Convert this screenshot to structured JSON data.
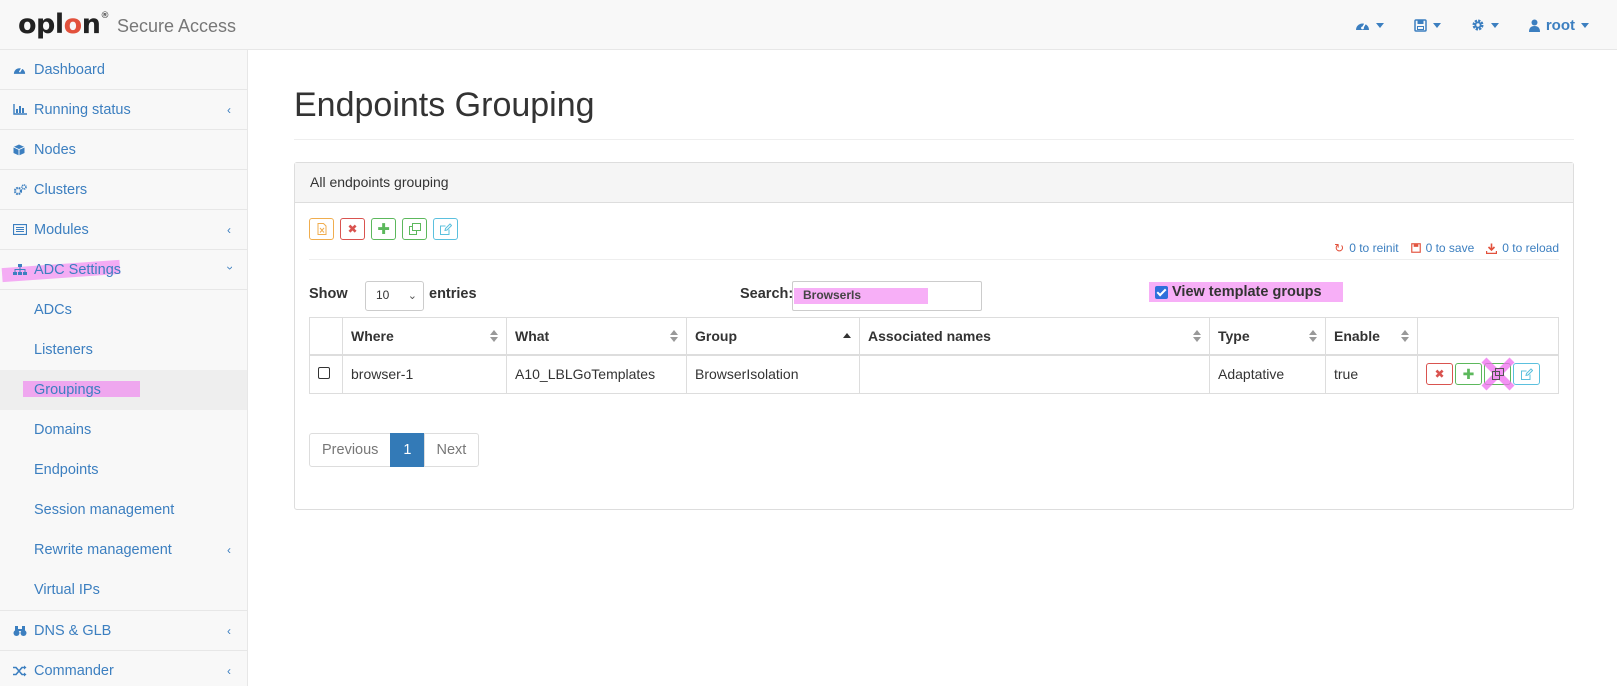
{
  "brand": {
    "name_pre": "opl",
    "name_o": "o",
    "name_post": "n",
    "reg": "®",
    "subtitle": "Secure Access"
  },
  "navbar": {
    "user": "root"
  },
  "sidebar": {
    "items": [
      {
        "label": "Dashboard"
      },
      {
        "label": "Running status"
      },
      {
        "label": "Nodes"
      },
      {
        "label": "Clusters"
      },
      {
        "label": "Modules"
      },
      {
        "label": "ADC Settings"
      }
    ],
    "adc_sub": [
      {
        "label": "ADCs"
      },
      {
        "label": "Listeners"
      },
      {
        "label": "Groupings"
      },
      {
        "label": "Domains"
      },
      {
        "label": "Endpoints"
      },
      {
        "label": "Session management"
      },
      {
        "label": "Rewrite management"
      },
      {
        "label": "Virtual IPs"
      }
    ],
    "bottom_items": [
      {
        "label": "DNS & GLB"
      },
      {
        "label": "Commander"
      }
    ]
  },
  "page": {
    "title": "Endpoints Grouping",
    "panel_title": "All endpoints grouping",
    "status": {
      "reinit": "0 to reinit",
      "save": "0 to save",
      "reload": "0 to reload"
    },
    "show_label": "Show",
    "show_value": "10",
    "entries_label": "entries",
    "search_label": "Search:",
    "search_value": "BrowserIs",
    "template_label": "View template groups",
    "template_checked": true
  },
  "table": {
    "headers": [
      "Where",
      "What",
      "Group",
      "Associated names",
      "Type",
      "Enable"
    ],
    "rows": [
      {
        "where": "browser-1",
        "what": "A10_LBLGoTemplates",
        "group": "BrowserIsolation",
        "names": "",
        "type": "Adaptative",
        "enable": "true"
      }
    ]
  },
  "pagination": {
    "prev": "Previous",
    "page": "1",
    "next": "Next"
  },
  "colors": {
    "link": "#3c7fc0",
    "primary": "#337ab7",
    "danger": "#d9534f",
    "success": "#5cb85c",
    "info": "#5bc0de",
    "warning": "#f0ad4e",
    "highlight": "#f06ef0"
  }
}
